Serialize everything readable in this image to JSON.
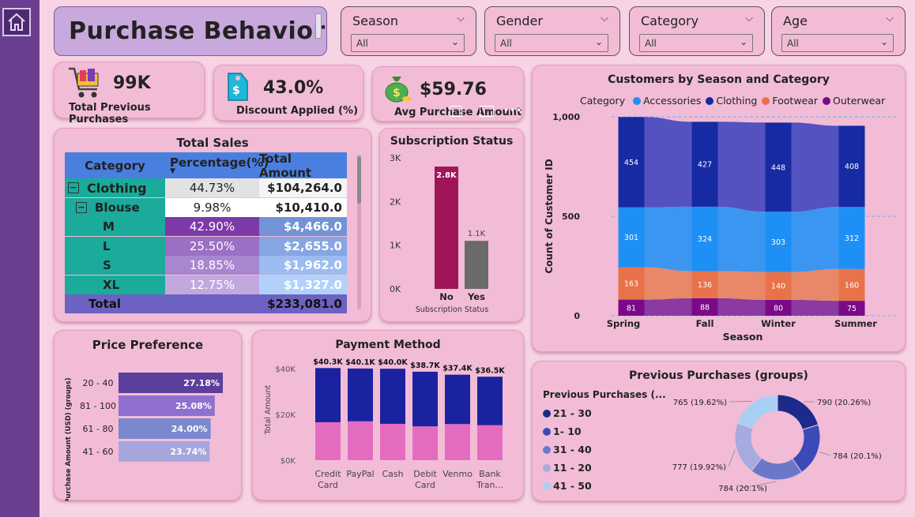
{
  "dashboard_title": "Purchase Behavior",
  "filters": [
    {
      "label": "Season",
      "value": "All"
    },
    {
      "label": "Gender",
      "value": "All"
    },
    {
      "label": "Category",
      "value": "All"
    },
    {
      "label": "Age",
      "value": "All"
    }
  ],
  "kpis": [
    {
      "value": "99K",
      "label": "Total Previous Purchases",
      "icon": "shopping-cart-icon"
    },
    {
      "value": "43.0%",
      "label": "Discount Applied (%)",
      "icon": "price-tag-icon"
    },
    {
      "value": "$59.76",
      "label": "Avg Purchase Amount",
      "icon": "money-bag-icon"
    }
  ],
  "total_sales": {
    "title": "Total Sales",
    "columns": [
      "Category",
      "Percentage(%)",
      "Total Amount"
    ],
    "rows": [
      {
        "category": "Clothing",
        "pct": "44.73%",
        "amount": "$104,264.0",
        "level": 0,
        "expander": "⊟"
      },
      {
        "category": "Blouse",
        "pct": "9.98%",
        "amount": "$10,410.0",
        "level": 1,
        "expander": "⊟"
      },
      {
        "category": "M",
        "pct": "42.90%",
        "amount": "$4,466.0",
        "level": 2
      },
      {
        "category": "L",
        "pct": "25.50%",
        "amount": "$2,655.0",
        "level": 2
      },
      {
        "category": "S",
        "pct": "18.85%",
        "amount": "$1,962.0",
        "level": 2
      },
      {
        "category": "XL",
        "pct": "12.75%",
        "amount": "$1,327.0",
        "level": 2
      }
    ],
    "total": {
      "label": "Total",
      "pct": "",
      "amount": "$233,081.0"
    }
  },
  "subscription": {
    "title": "Subscription Status",
    "xlabel": "Subscription Status",
    "ytick_labels": [
      "3K",
      "2K",
      "1K",
      "0K"
    ]
  },
  "season_chart": {
    "title": "Customers by Season and Category",
    "legend_title": "Category",
    "xlabel": "Season",
    "ylabel": "Count of Customer ID",
    "ytick_labels": [
      "1,000",
      "500",
      "0"
    ]
  },
  "price_pref": {
    "title": "Price Preference",
    "ylabel": "Purchase Amount (USD) (groups)"
  },
  "payment": {
    "title": "Payment Method",
    "ylabel": "Total Amount",
    "ytick_labels": [
      "$40K",
      "$20K",
      "$0K"
    ],
    "categories_display": [
      [
        "Credit",
        "Card"
      ],
      [
        "PayPal"
      ],
      [
        "Cash"
      ],
      [
        "Debit",
        "Card"
      ],
      [
        "Venmo"
      ],
      [
        "Bank",
        "Tran..."
      ]
    ]
  },
  "prev_purchases": {
    "title": "Previous Purchases (groups)",
    "legend_title": "Previous Purchases (..."
  },
  "colors": {
    "accessories": "#1e90f5",
    "clothing": "#162aa3",
    "footwear": "#e8734a",
    "outerwear": "#7a0a8a",
    "sub_no": "#a01458",
    "sub_yes": "#6a6a6a",
    "pay_top": "#1a22a0",
    "pay_bottom": "#e46cc0"
  },
  "chart_data": [
    {
      "type": "bar",
      "title": "Subscription Status",
      "xlabel": "Subscription Status",
      "categories": [
        "No",
        "Yes"
      ],
      "values": [
        2800,
        1100
      ],
      "data_labels": [
        "2.8K",
        "1.1K"
      ],
      "ylim": [
        0,
        3000
      ]
    },
    {
      "type": "bar",
      "title": "Customers by Season and Category",
      "xlabel": "Season",
      "ylabel": "Count of Customer ID",
      "categories": [
        "Spring",
        "Fall",
        "Winter",
        "Summer"
      ],
      "series": [
        {
          "name": "Outerwear",
          "values": [
            81,
            88,
            80,
            75
          ]
        },
        {
          "name": "Footwear",
          "values": [
            163,
            136,
            140,
            160
          ]
        },
        {
          "name": "Accessories",
          "values": [
            301,
            324,
            303,
            312
          ]
        },
        {
          "name": "Clothing",
          "values": [
            454,
            427,
            448,
            408
          ]
        }
      ],
      "ylim": [
        0,
        1000
      ],
      "legend": "top"
    },
    {
      "type": "bar",
      "title": "Price Preference",
      "ylabel": "Purchase Amount (USD) (groups)",
      "categories": [
        "20 - 40",
        "81 - 100",
        "61 - 80",
        "41 - 60"
      ],
      "values": [
        27.18,
        25.08,
        24.0,
        23.74
      ],
      "data_labels": [
        "27.18%",
        "25.08%",
        "24.00%",
        "23.74%"
      ],
      "bar_colors": [
        "#5c3f9c",
        "#8f70cf",
        "#7a88cf",
        "#a6a6dc"
      ]
    },
    {
      "type": "bar",
      "title": "Payment Method",
      "ylabel": "Total Amount",
      "categories": [
        "Credit Card",
        "PayPal",
        "Cash",
        "Debit Card",
        "Venmo",
        "Bank Tran..."
      ],
      "series": [
        {
          "values": [
            16600,
            17000,
            15900,
            14800,
            15800,
            15300
          ]
        },
        {
          "values": [
            23700,
            23100,
            24100,
            23900,
            21600,
            21200
          ]
        }
      ],
      "totals": [
        40300,
        40100,
        40000,
        38700,
        37400,
        36500
      ],
      "data_labels": [
        "$40.3K",
        "$40.1K",
        "$40.0K",
        "$38.7K",
        "$37.4K",
        "$36.5K"
      ],
      "ylim": [
        0,
        48000
      ]
    },
    {
      "type": "pie",
      "title": "Previous Purchases (groups)",
      "categories": [
        "21 - 30",
        "1- 10",
        "31 - 40",
        "11 - 20",
        "41 - 50"
      ],
      "values": [
        790,
        784,
        784,
        777,
        765
      ],
      "data_labels": [
        "790 (20.26%)",
        "784 (20.1%)",
        "784 (20.1%)",
        "777 (19.92%)",
        "765 (19.62%)"
      ],
      "colors": [
        "#1c2a8c",
        "#3a4bb8",
        "#6b78c9",
        "#a6aade",
        "#a9cff5"
      ],
      "legend": "left"
    }
  ]
}
